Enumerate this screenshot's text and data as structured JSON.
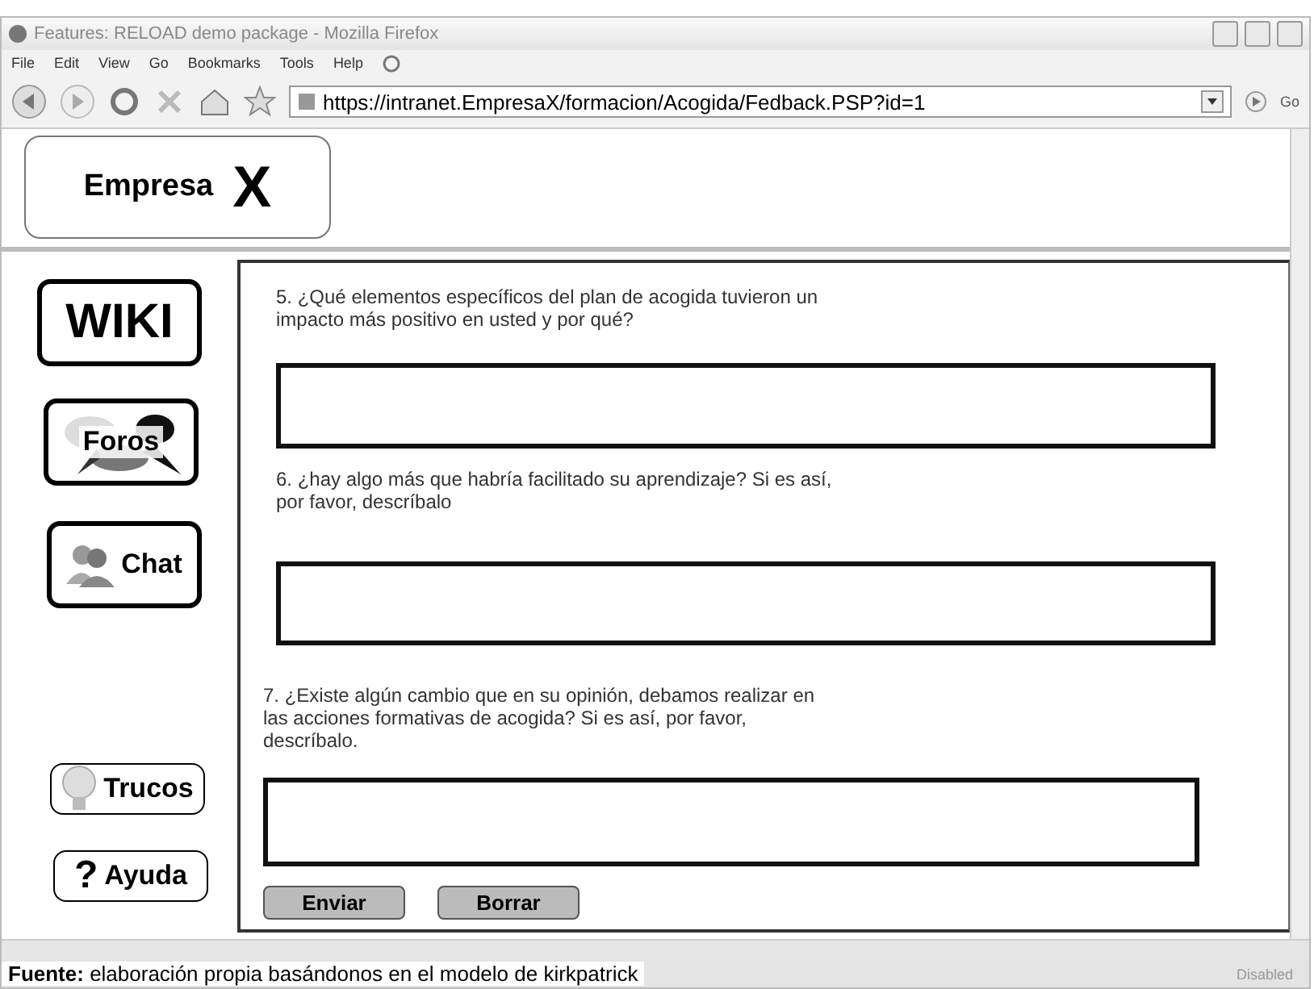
{
  "window": {
    "title": "Features: RELOAD demo package - Mozilla Firefox"
  },
  "menu": [
    "File",
    "Edit",
    "View",
    "Go",
    "Bookmarks",
    "Tools",
    "Help"
  ],
  "address": {
    "url": "https://intranet.EmpresaX/formacion/Acogida/Fedback.PSP?id=1",
    "go": "Go"
  },
  "logo": {
    "word": "Empresa",
    "letter": "X"
  },
  "sidebar": [
    {
      "kind": "wiki",
      "label": "WIKI"
    },
    {
      "kind": "foros",
      "label": "Foros"
    },
    {
      "kind": "chat",
      "label": "Chat"
    },
    {
      "kind": "trucos",
      "label": "Trucos"
    },
    {
      "kind": "ayuda",
      "label": "Ayuda",
      "mark": "?"
    }
  ],
  "questions": [
    {
      "text": "5. ¿Qué elementos específicos del plan de acogida tuvieron un\nimpacto más positivo en usted y por qué?"
    },
    {
      "text": "6. ¿hay algo más que habría facilitado su aprendizaje? Si es así,\npor favor, descríbalo"
    },
    {
      "text": "7. ¿Existe algún cambio que en su opinión, debamos realizar en\nlas acciones formativas de acogida? Si es así, por favor,\ndescríbalo."
    }
  ],
  "buttons": [
    "Enviar",
    "Borrar"
  ],
  "status": "Disabled",
  "caption": "**Fuente:** elaboración propia basándonos en el modelo de kirkpatrick"
}
